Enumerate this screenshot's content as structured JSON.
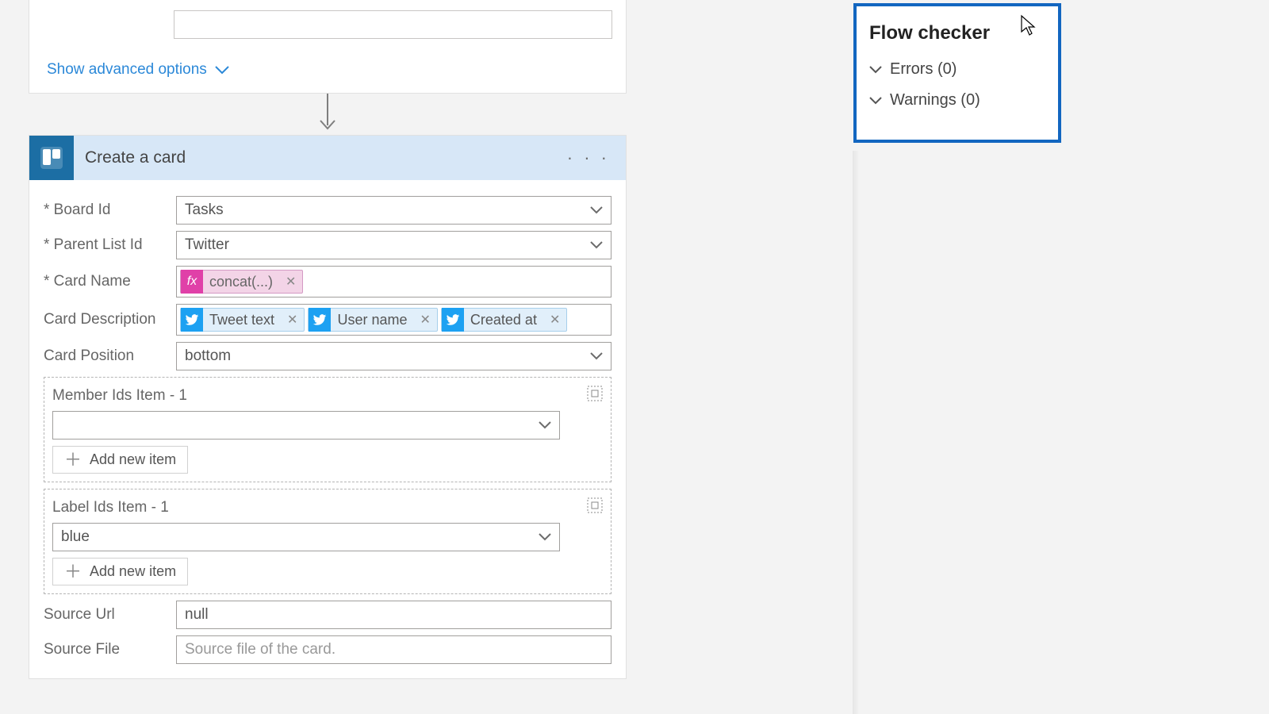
{
  "prev_card": {
    "show_advanced": "Show advanced options"
  },
  "action": {
    "title": "Create a card",
    "menu_dots": "· · ·",
    "fields": {
      "board_id": {
        "label": "* Board Id",
        "value": "Tasks"
      },
      "parent_list_id": {
        "label": "* Parent List Id",
        "value": "Twitter"
      },
      "card_name": {
        "label": "* Card Name",
        "fx_token": "concat(...)"
      },
      "card_description": {
        "label": "Card Description",
        "tokens": [
          "Tweet text",
          "User name",
          "Created at"
        ]
      },
      "card_position": {
        "label": "Card Position",
        "value": "bottom"
      },
      "member_ids": {
        "label": "Member Ids Item - 1",
        "value": "",
        "add": "Add new item"
      },
      "label_ids": {
        "label": "Label Ids Item - 1",
        "value": "blue",
        "add": "Add new item"
      },
      "source_url": {
        "label": "Source Url",
        "value": "null"
      },
      "source_file": {
        "label": "Source File",
        "placeholder": "Source file of the card."
      }
    }
  },
  "flow_checker": {
    "title": "Flow checker",
    "errors": "Errors (0)",
    "warnings": "Warnings (0)"
  }
}
